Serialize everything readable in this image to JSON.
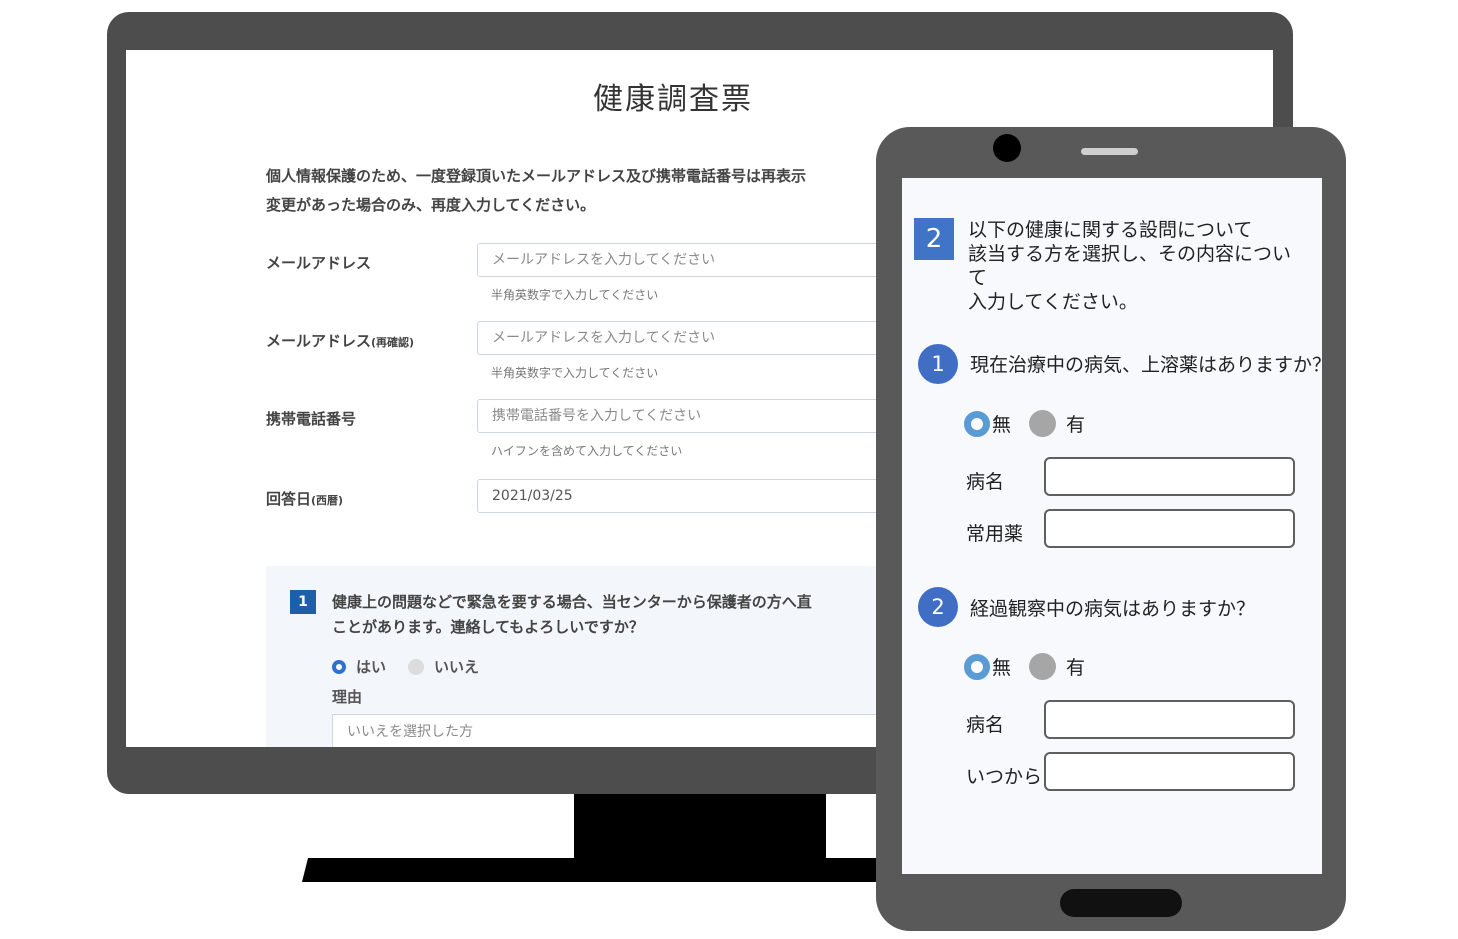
{
  "desktop": {
    "title": "健康調査票",
    "intro_line1": "個人情報保護のため、一度登録頂いたメールアドレス及び携帯電話番号は再表示",
    "intro_line2": "変更があった場合のみ、再度入力してください。",
    "fields": [
      {
        "label": "メールアドレス",
        "label_small": "",
        "placeholder": "メールアドレスを入力してください",
        "help": "半角英数字で入力してください"
      },
      {
        "label": "メールアドレス",
        "label_small": "(再確認)",
        "placeholder": "メールアドレスを入力してください",
        "help": "半角英数字で入力してください"
      },
      {
        "label": "携帯電話番号",
        "label_small": "",
        "placeholder": "携帯電話番号を入力してください",
        "help": "ハイフンを含めて入力してください"
      },
      {
        "label": "回答日",
        "label_small": "(西暦)",
        "value": "2021/03/25"
      }
    ],
    "question": {
      "number": "1",
      "line1": "健康上の問題などで緊急を要する場合、当センターから保護者の方へ直",
      "line2": "ことがあります。連絡してもよろしいですか？",
      "option_yes": "はい",
      "option_no": "いいえ",
      "reason_label": "理由",
      "reason_placeholder": "いいえを選択した方"
    }
  },
  "tablet": {
    "section_number": "2",
    "intro": "以下の健康に関する設問について\n該当する方を選択し、その内容について\n入力してください。",
    "questions": [
      {
        "number": "1",
        "text": "現在治療中の病気、上溶薬はありますか？",
        "option_no": "無",
        "option_yes": "有",
        "field1_label": "病名",
        "field2_label": "常用薬"
      },
      {
        "number": "2",
        "text": "経過観察中の病気はありますか？",
        "option_no": "無",
        "option_yes": "有",
        "field1_label": "病名",
        "field2_label": "いつから"
      }
    ]
  },
  "colors": {
    "accent_dark": "#1d5fa8",
    "accent_tablet": "#3f6ec4",
    "device_gray": "#4d4d4d"
  }
}
